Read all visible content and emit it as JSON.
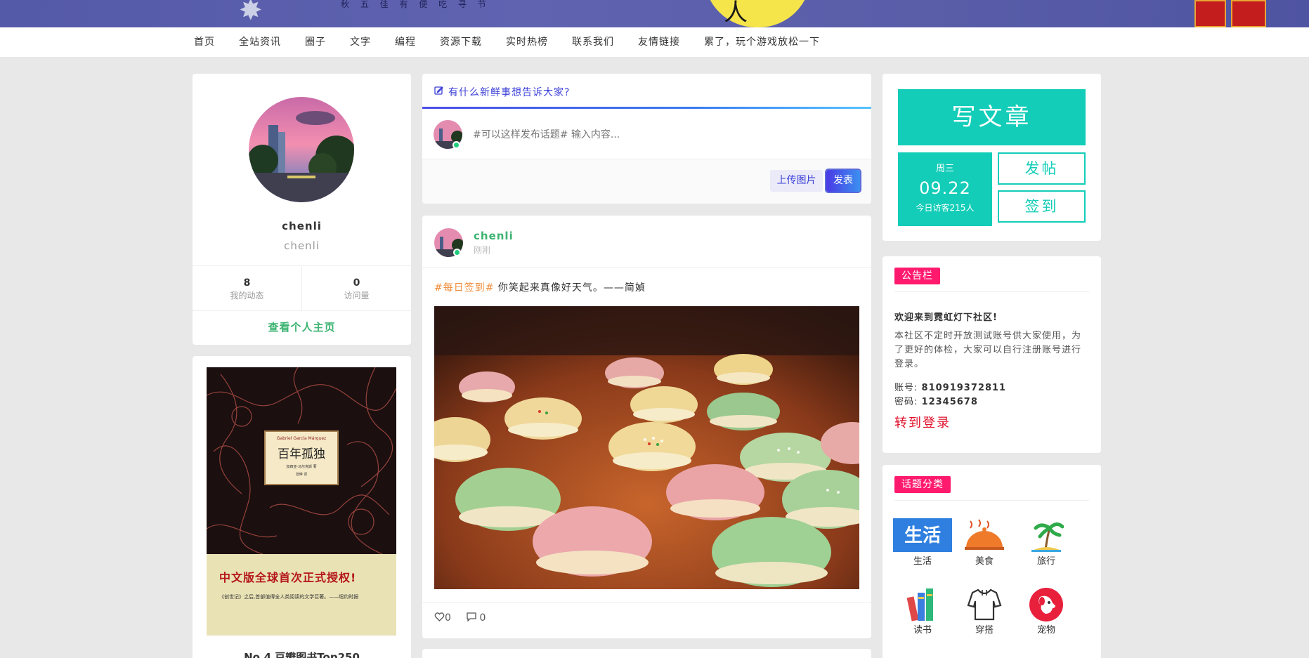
{
  "banner": {
    "moon_char": "人",
    "verse": "秋 五 佳 有 便 吃 寻 节"
  },
  "nav": {
    "items": [
      "首页",
      "全站资讯",
      "圈子",
      "文字",
      "编程",
      "资源下载",
      "实时热榜",
      "联系我们",
      "友情链接",
      "累了，玩个游戏放松一下"
    ]
  },
  "profile": {
    "name": "chenli",
    "subtitle": "chenli",
    "stats": [
      {
        "value": "8",
        "label": "我的动态"
      },
      {
        "value": "0",
        "label": "访问量"
      }
    ],
    "home_link": "查看个人主页"
  },
  "book": {
    "cover_author_en": "Gabriel García Márquez",
    "cover_title": "百年孤独",
    "cover_author_zh": "加西亚·马尔克斯 著",
    "cover_translator": "范晔 译",
    "slogan": "中文版全球首次正式授权!",
    "blurb": "《创世记》之后,首部值得全人类阅读的文学巨著。——纽约时报",
    "caption": "No.4 豆瓣图书Top250"
  },
  "composer": {
    "title": "有什么新鲜事想告诉大家?",
    "placeholder": "#可以这样发布话题# 输入内容...",
    "upload_label": "上传图片",
    "publish_label": "发表"
  },
  "post": {
    "author": "chenli",
    "time": "刚刚",
    "tag": "#每日签到#",
    "text": " 你笑起来真像好天气。——简媜",
    "likes": "0",
    "comments": "0"
  },
  "actions": {
    "write_label": "写文章",
    "weekday": "周三",
    "date": "09.22",
    "visitors": "今日访客215人",
    "post_label": "发帖",
    "checkin_label": "签到"
  },
  "notice": {
    "badge": "公告栏",
    "welcome": "欢迎来到霓虹灯下社区!",
    "description": "本社区不定时开放测试账号供大家使用，为了更好的体检，大家可以自行注册账号进行登录。",
    "account_label": "账号:",
    "account_value": "810919372811",
    "password_label": "密码:",
    "password_value": "12345678",
    "login_link": "转到登录"
  },
  "topics": {
    "badge": "话题分类",
    "items": [
      {
        "name": "生活",
        "icon": "life-icon"
      },
      {
        "name": "美食",
        "icon": "food-icon"
      },
      {
        "name": "旅行",
        "icon": "travel-icon"
      },
      {
        "name": "读书",
        "icon": "books-icon"
      },
      {
        "name": "穿搭",
        "icon": "clothes-icon"
      },
      {
        "name": "宠物",
        "icon": "pet-icon"
      }
    ]
  },
  "colors": {
    "accent_teal": "#13cdb8",
    "accent_blue": "#3b3fd8",
    "badge_pink": "#ff1a6e",
    "username_green": "#3cb371",
    "tag_orange": "#f08c3a"
  }
}
